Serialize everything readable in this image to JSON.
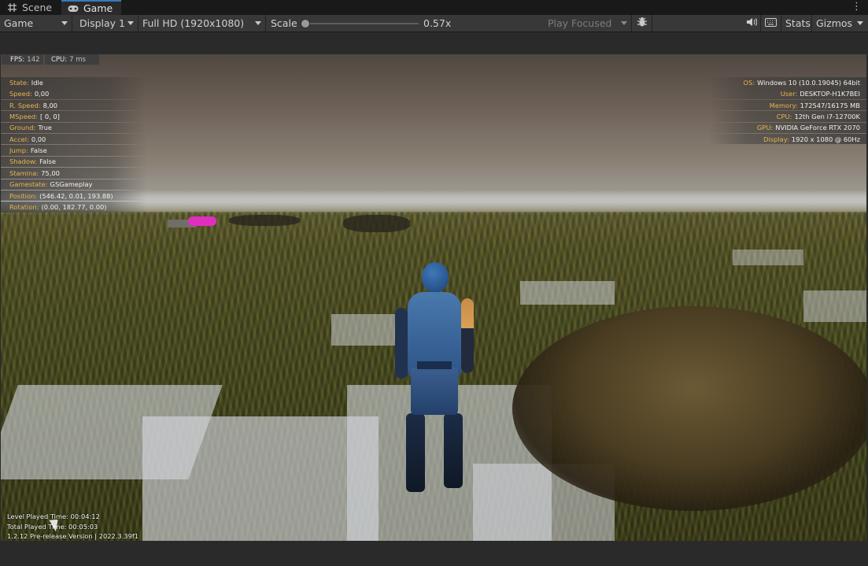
{
  "tabs": {
    "scene": {
      "label": "Scene",
      "icon": "grid-icon"
    },
    "game": {
      "label": "Game",
      "icon": "gamepad-icon"
    }
  },
  "toolbar": {
    "view_mode": "Game",
    "display": "Display 1",
    "resolution": "Full HD (1920x1080)",
    "scale_label": "Scale",
    "scale_value": "0.57x",
    "scale_fraction": 0.0,
    "play_mode": "Play Focused",
    "stats_label": "Stats",
    "gizmos_label": "Gizmos",
    "icons": [
      "bug-icon",
      "speaker-icon",
      "keyboard-icon",
      "kebab-menu-icon"
    ]
  },
  "perf": {
    "fps_label": "FPS:",
    "fps_value": "142",
    "cpu_label": "CPU:",
    "cpu_value": "7 ms"
  },
  "stats_left": [
    {
      "k": "State:",
      "v": "Idle"
    },
    {
      "k": "Speed:",
      "v": "0,00"
    },
    {
      "k": "R. Speed:",
      "v": "8,00"
    },
    {
      "k": "MSpeed:",
      "v": "[ 0, 0]"
    },
    {
      "k": "Ground:",
      "v": "True"
    },
    {
      "k": "Accel:",
      "v": "0,00"
    },
    {
      "k": "Jump:",
      "v": "False"
    },
    {
      "k": "Shadow:",
      "v": "False"
    },
    {
      "k": "Stamina:",
      "v": "75,00"
    },
    {
      "k": "Gamestate:",
      "v": "GSGameplay"
    },
    {
      "k": "Position:",
      "v": "(546.42, 0.01, 193.88)"
    },
    {
      "k": "Rotation:",
      "v": "(0.00, 182.77, 0.00)"
    }
  ],
  "stats_right": [
    {
      "k": "OS:",
      "v": "Windows 10  (10.0.19045) 64bit"
    },
    {
      "k": "User:",
      "v": "DESKTOP-H1K7BEI"
    },
    {
      "k": "Memory:",
      "v": "172547/16175 MB"
    },
    {
      "k": "CPU:",
      "v": "12th Gen i7-12700K"
    },
    {
      "k": "GPU:",
      "v": "NVIDIA GeForce RTX 2070"
    },
    {
      "k": "Display:",
      "v": "1920 x 1080 @ 60Hz"
    }
  ],
  "bottom": {
    "level_time": "Level Played Time: 00:04:12",
    "total_time": "Total Played Time: 00:05:03",
    "version": "1.2.12 Pre-release Version | 2022.3.39f1"
  }
}
